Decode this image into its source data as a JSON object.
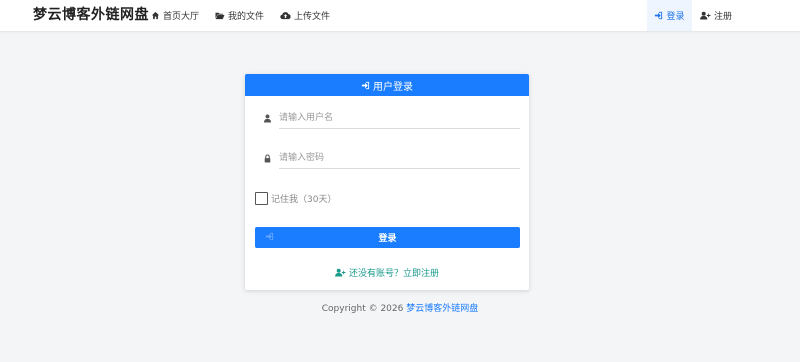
{
  "navbar": {
    "brand": "梦云博客外链网盘",
    "items": [
      {
        "label": "首页大厅",
        "icon": "home-icon"
      },
      {
        "label": "我的文件",
        "icon": "folder-open-icon"
      },
      {
        "label": "上传文件",
        "icon": "cloud-upload-icon"
      }
    ],
    "right": [
      {
        "label": "登录",
        "icon": "sign-in-icon",
        "active": true
      },
      {
        "label": "注册",
        "icon": "user-plus-icon"
      }
    ]
  },
  "login_card": {
    "title": "用户登录",
    "title_icon": "sign-in-icon",
    "username": {
      "value": "",
      "placeholder": "请输入用户名",
      "icon": "user-icon"
    },
    "password": {
      "value": "",
      "placeholder": "请输入密码",
      "icon": "lock-icon"
    },
    "remember": {
      "label": "记住我（30天）",
      "checked": false
    },
    "submit_label": "登录",
    "register_link": {
      "label": "还没有账号？立即注册",
      "icon": "user-plus-icon"
    }
  },
  "footer": {
    "copyright": "Copyright © 2026",
    "site_link": "梦云博客外链网盘"
  },
  "colors": {
    "primary": "#1a7cff",
    "register_link": "#1a9a8a",
    "page_background": "#f4f5f7",
    "active_nav_background": "#eef5ff"
  }
}
